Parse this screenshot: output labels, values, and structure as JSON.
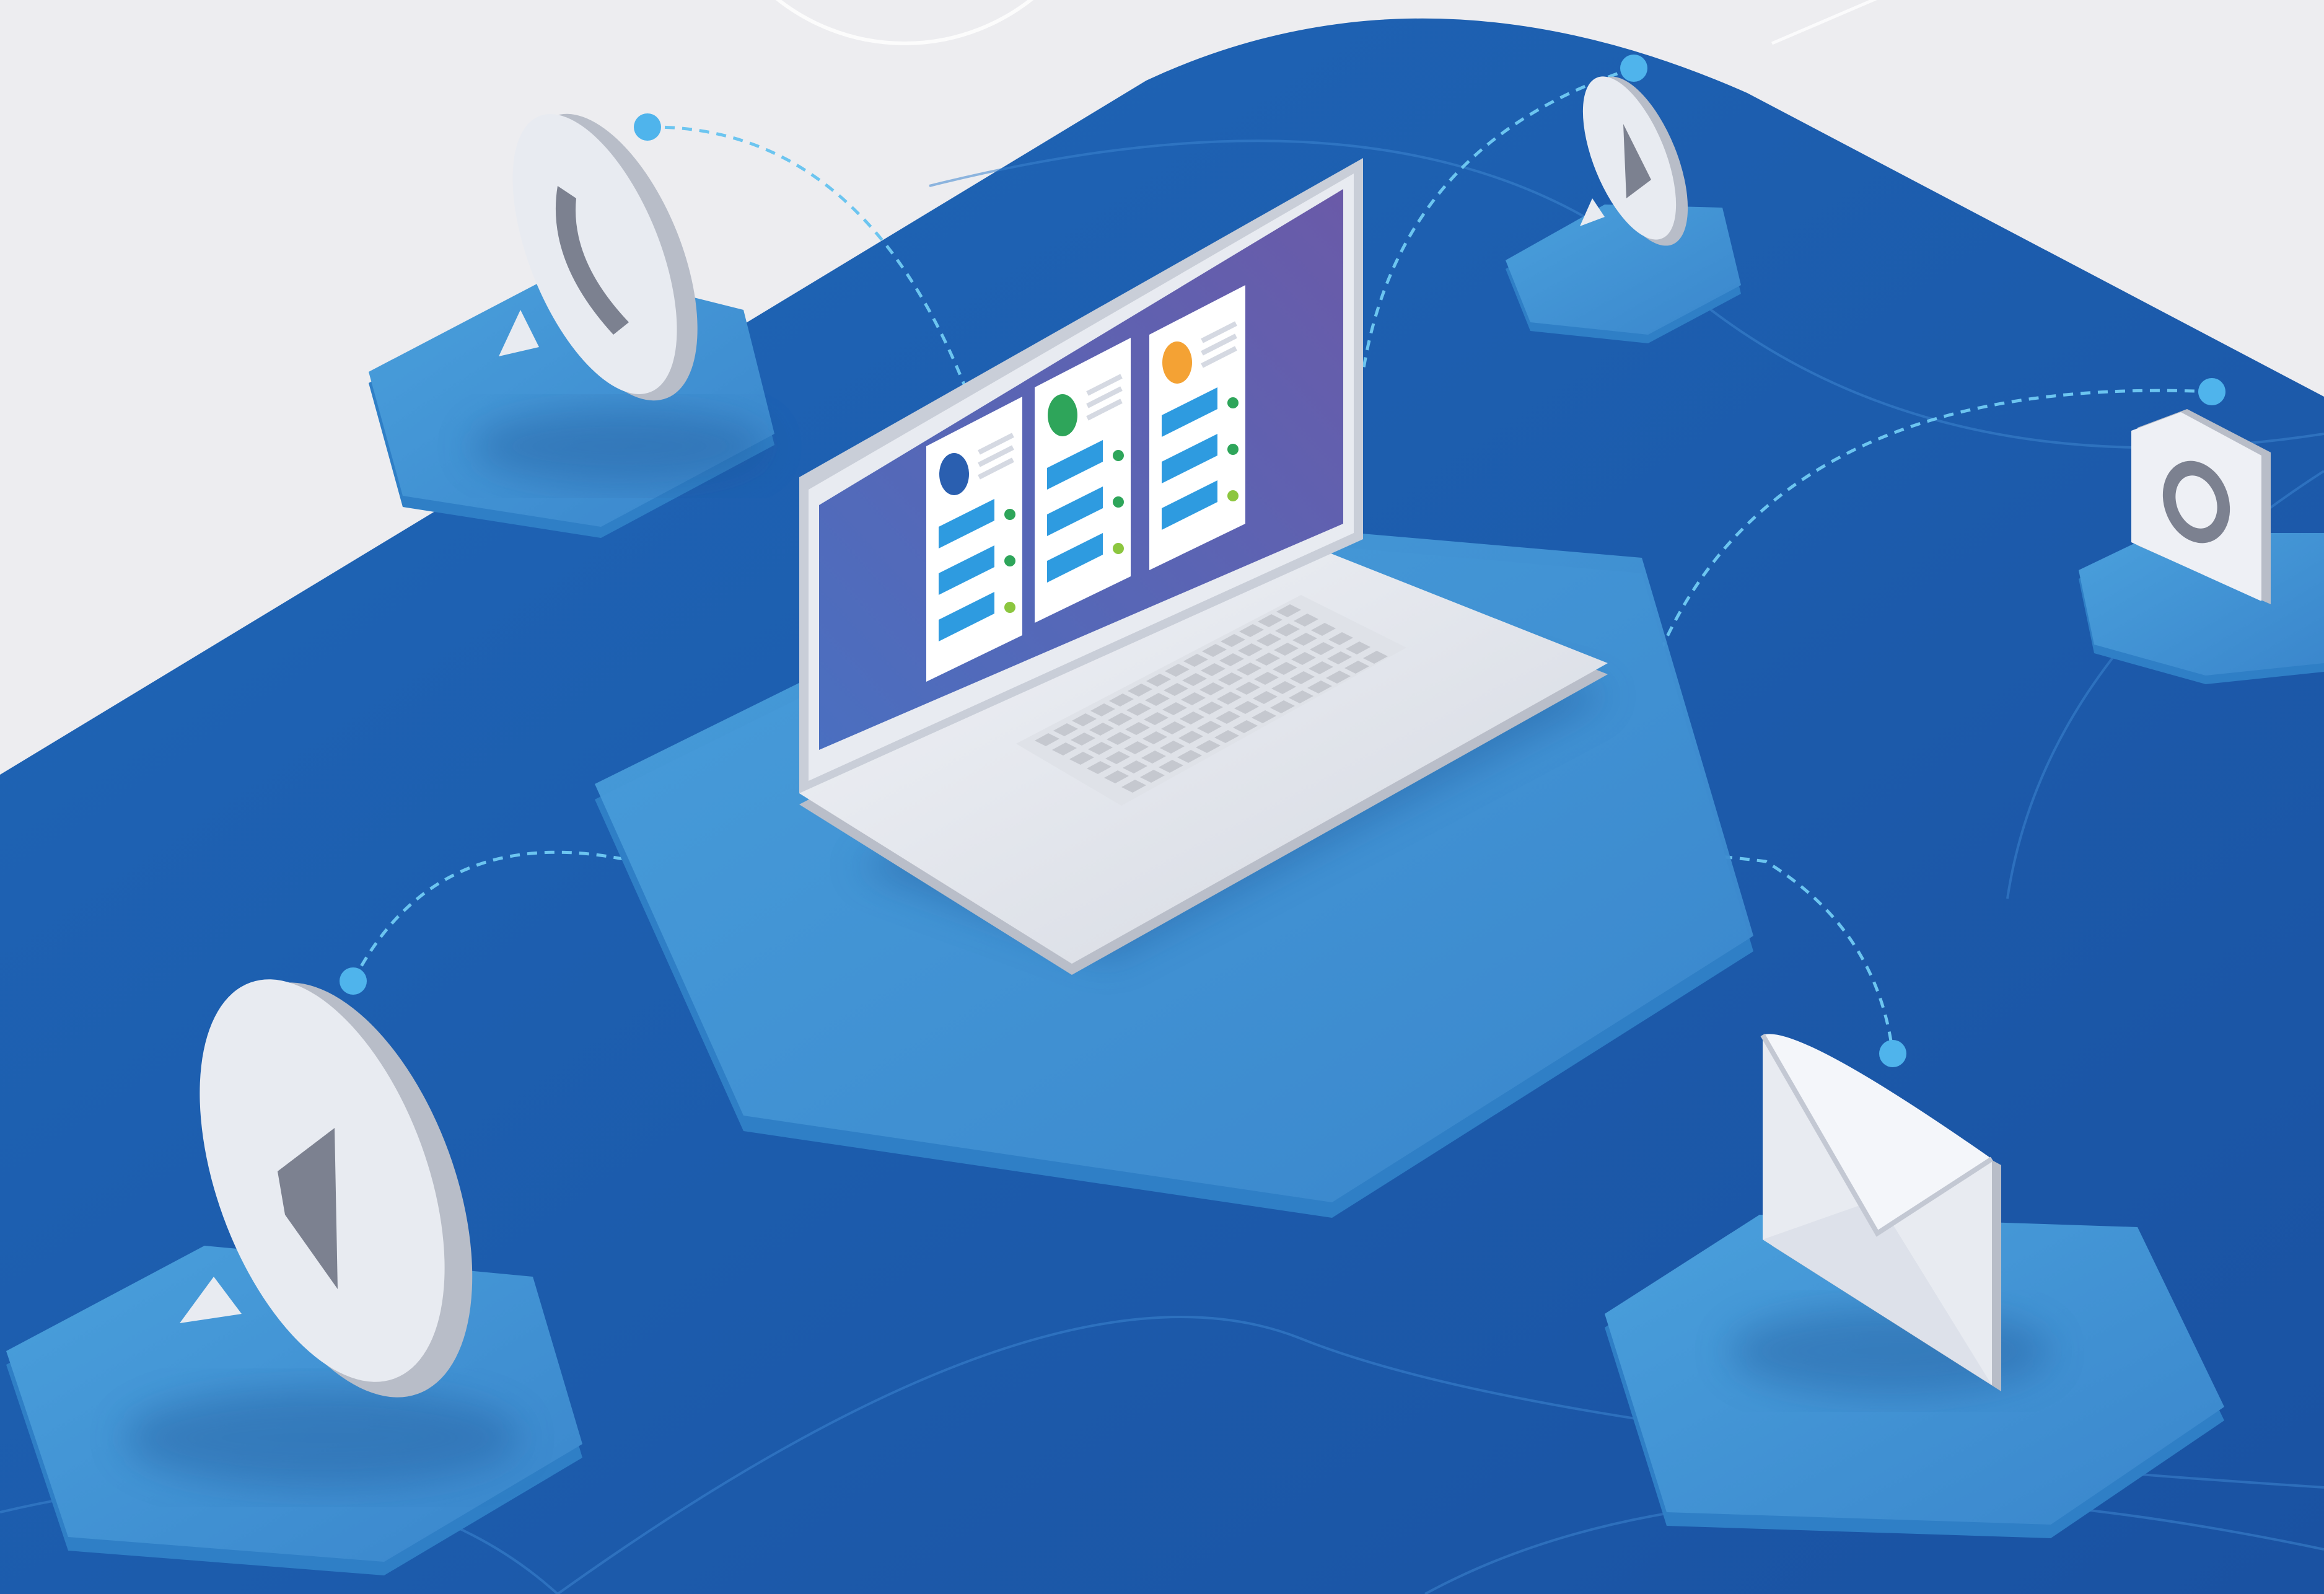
{
  "scene": {
    "kind": "isometric illustration",
    "colors": {
      "background_light": "#ededf0",
      "ground_blue": "#1e63b4",
      "ground_blue_deep": "#1a56a6",
      "platform_blue": "#3f95d6",
      "platform_edge": "#2f7fc6",
      "connector": "#6cc5f0",
      "device_silver": "#e6e9f0",
      "device_shadow": "#c3c8d3",
      "screen_gradient_start": "#4a6fc0",
      "screen_gradient_end": "#6a5aa8",
      "card_white": "#ffffff",
      "avatar_blue": "#2a5fb0",
      "avatar_green": "#2ea55a",
      "avatar_orange": "#f4a234",
      "field_blue": "#2e9be0",
      "key_grey": "#c5c8cf"
    },
    "icons": [
      "laptop-icon",
      "phone-chat-bubble-icon",
      "play-chat-bubble-icon",
      "camera-icon",
      "megaphone-chat-bubble-icon",
      "envelope-icon"
    ],
    "screen_cards": [
      {
        "avatar_color": "#2a5fb0"
      },
      {
        "avatar_color": "#2ea55a"
      },
      {
        "avatar_color": "#f4a234"
      }
    ]
  }
}
